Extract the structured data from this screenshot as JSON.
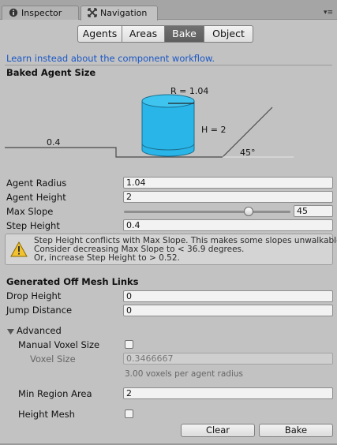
{
  "tabs": {
    "inspector_label": "Inspector",
    "navigation_label": "Navigation",
    "menu_glyph": "▾≡"
  },
  "modes": [
    "Agents",
    "Areas",
    "Bake",
    "Object"
  ],
  "active_mode": "Bake",
  "link_text": "Learn instead about the component workflow.",
  "baked_agent_size": {
    "heading": "Baked Agent Size",
    "diagram": {
      "radius_label": "R = 1.04",
      "height_label": "H = 2",
      "step_label": "0.4",
      "slope_label": "45°",
      "cylinder_color": "#29b5e8"
    }
  },
  "agent_fields": [
    {
      "label": "Agent Radius",
      "value": "1.04"
    },
    {
      "label": "Agent Height",
      "value": "2"
    },
    {
      "label": "Max Slope",
      "value": "45"
    },
    {
      "label": "Step Height",
      "value": "0.4"
    }
  ],
  "max_slope": {
    "min": 0,
    "max": 60,
    "value": 45
  },
  "warning": {
    "line1": "Step Height conflicts with Max Slope. This makes some slopes unwalkable.",
    "line2": "Consider decreasing Max Slope to < 36.9 degrees.",
    "line3": "Or, increase Step Height to > 0.52."
  },
  "off_mesh": {
    "heading": "Generated Off Mesh Links",
    "fields": [
      {
        "label": "Drop Height",
        "value": "0"
      },
      {
        "label": "Jump Distance",
        "value": "0"
      }
    ]
  },
  "advanced": {
    "label": "Advanced",
    "manual_voxel_label": "Manual Voxel Size",
    "manual_voxel_checked": false,
    "voxel_size_label": "Voxel Size",
    "voxel_size_value": "0.3466667",
    "voxel_hint": "3.00 voxels per agent radius",
    "min_region_label": "Min Region Area",
    "min_region_value": "2",
    "height_mesh_label": "Height Mesh",
    "height_mesh_checked": false
  },
  "buttons": {
    "clear": "Clear",
    "bake": "Bake"
  },
  "colors": {
    "link": "#1b58c6",
    "active_tab": "#676767",
    "warning_icon": "#f2c230"
  }
}
